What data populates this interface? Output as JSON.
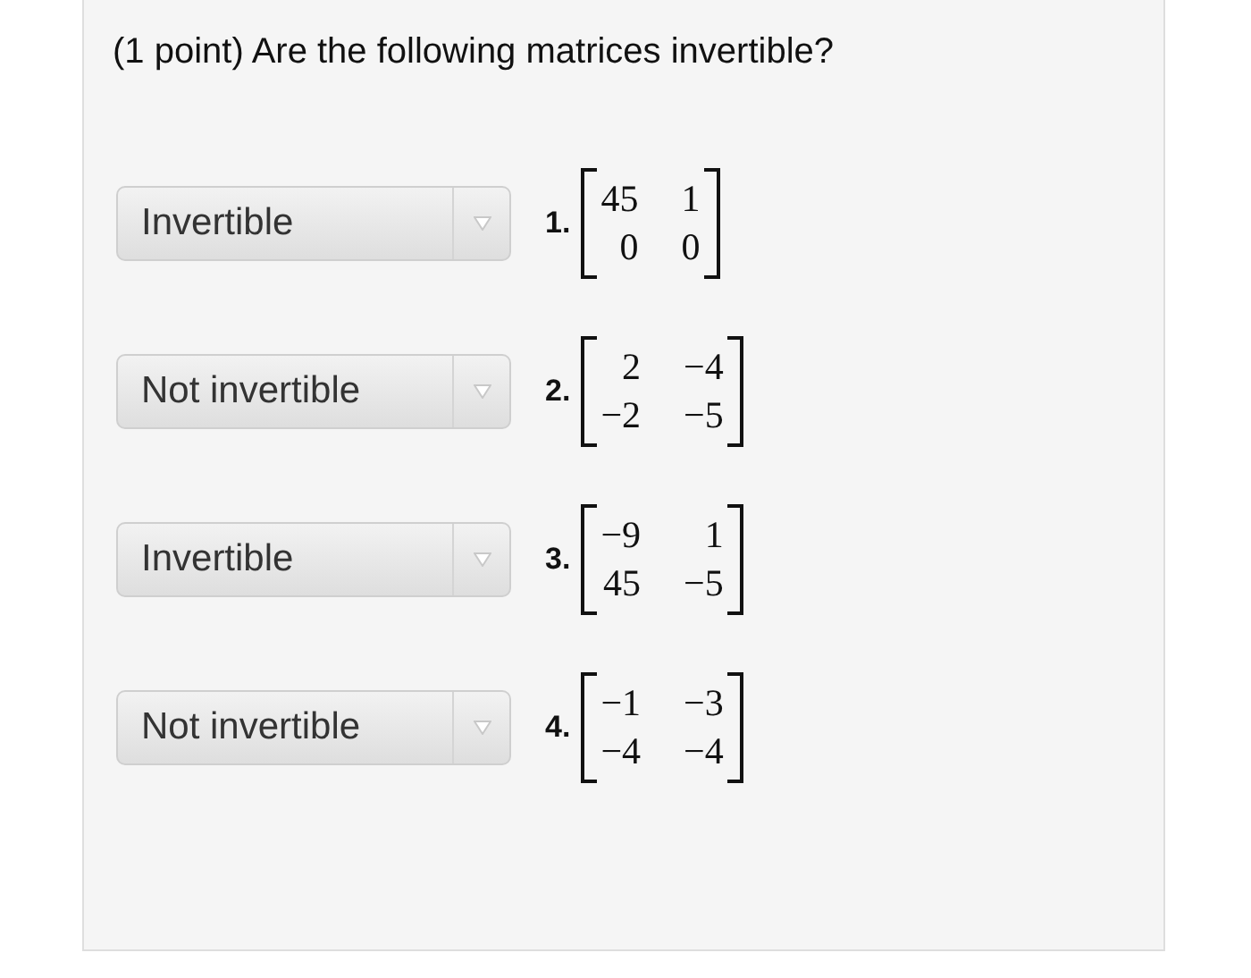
{
  "question": {
    "text": "(1 point) Are the following matrices invertible?"
  },
  "items": [
    {
      "answer": "Invertible",
      "number": "1.",
      "matrix": [
        [
          "45",
          "1"
        ],
        [
          "0",
          "0"
        ]
      ]
    },
    {
      "answer": "Not invertible",
      "number": "2.",
      "matrix": [
        [
          "2",
          "−4"
        ],
        [
          "−2",
          "−5"
        ]
      ]
    },
    {
      "answer": "Invertible",
      "number": "3.",
      "matrix": [
        [
          "−9",
          "1"
        ],
        [
          "45",
          "−5"
        ]
      ]
    },
    {
      "answer": "Not invertible",
      "number": "4.",
      "matrix": [
        [
          "−1",
          "−3"
        ],
        [
          "−4",
          "−4"
        ]
      ]
    }
  ]
}
